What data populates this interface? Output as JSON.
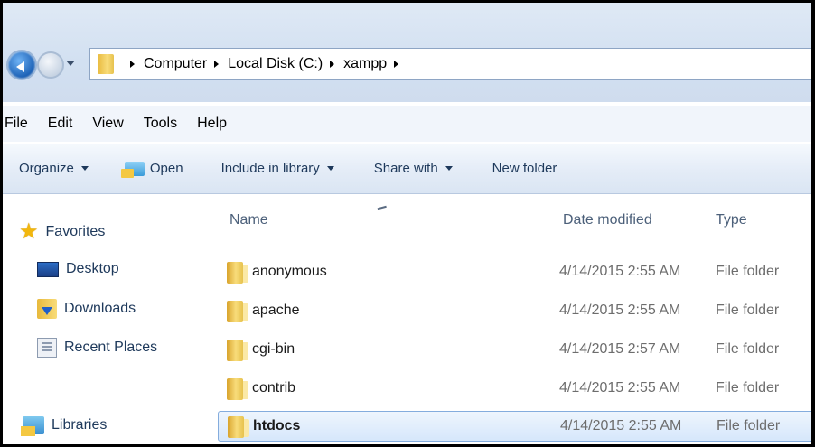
{
  "breadcrumbs": [
    "Computer",
    "Local Disk (C:)",
    "xampp"
  ],
  "menu": [
    "File",
    "Edit",
    "View",
    "Tools",
    "Help"
  ],
  "toolbar": {
    "organize": "Organize",
    "open": "Open",
    "include_in_library": "Include in library",
    "share_with": "Share with",
    "new_folder": "New folder"
  },
  "nav": {
    "favorites": "Favorites",
    "desktop": "Desktop",
    "downloads": "Downloads",
    "recent_places": "Recent Places",
    "libraries": "Libraries"
  },
  "columns": {
    "name": "Name",
    "date_modified": "Date modified",
    "type": "Type"
  },
  "files": [
    {
      "name": "anonymous",
      "date": "4/14/2015 2:55 AM",
      "type": "File folder"
    },
    {
      "name": "apache",
      "date": "4/14/2015 2:55 AM",
      "type": "File folder"
    },
    {
      "name": "cgi-bin",
      "date": "4/14/2015 2:57 AM",
      "type": "File folder"
    },
    {
      "name": "contrib",
      "date": "4/14/2015 2:55 AM",
      "type": "File folder"
    },
    {
      "name": "htdocs",
      "date": "4/14/2015 2:55 AM",
      "type": "File folder"
    }
  ],
  "colors": {
    "selection": "#d6e7fb",
    "selection_border": "#84acdd",
    "chrome": "#dae5f3",
    "text_link": "#1e395b"
  }
}
